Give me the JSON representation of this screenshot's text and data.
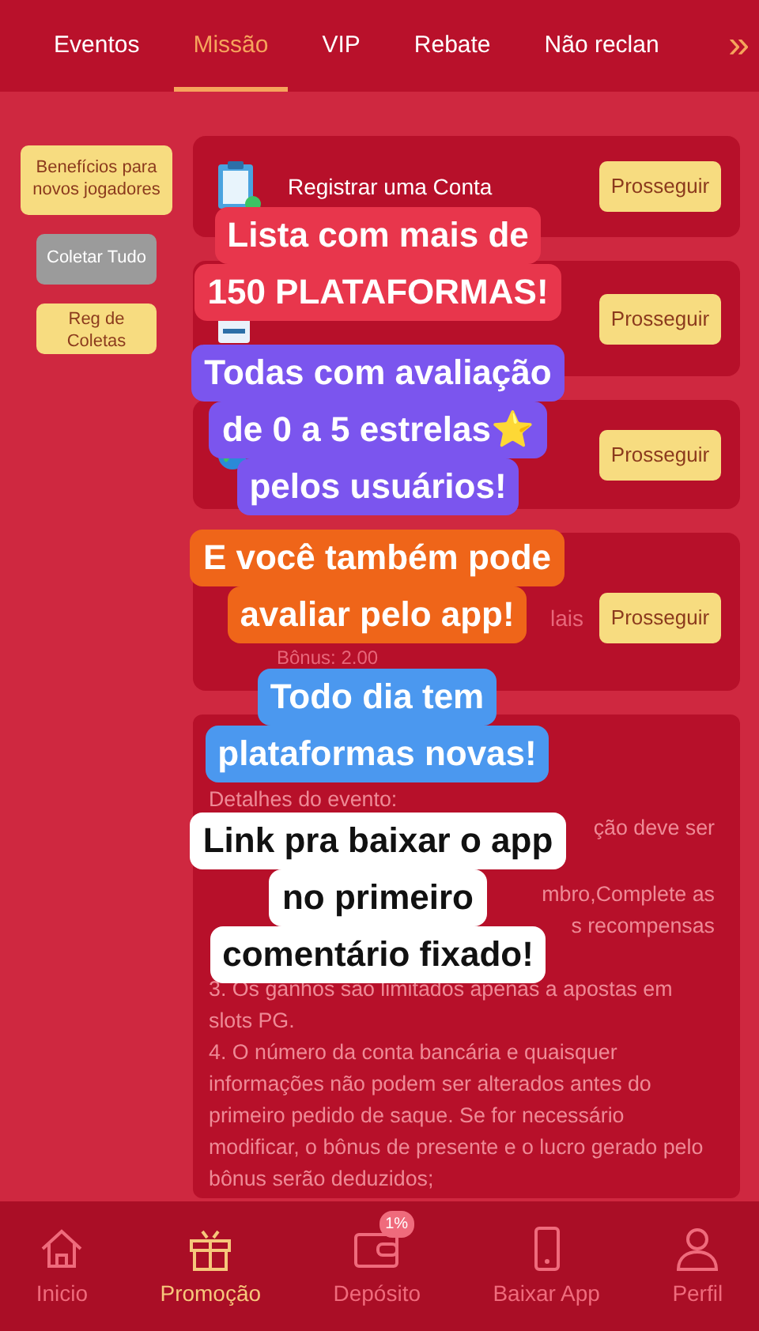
{
  "tabs": [
    {
      "label": "Eventos",
      "selected": false
    },
    {
      "label": "Missão",
      "selected": true
    },
    {
      "label": "VIP",
      "selected": false
    },
    {
      "label": "Rebate",
      "selected": false
    },
    {
      "label": "Não reclan",
      "selected": false
    }
  ],
  "tabs_more": "»",
  "side_buttons": [
    {
      "label": "Benefícios para novos jogadores",
      "kind": "yellow"
    },
    {
      "label": "Coletar Tudo",
      "kind": "gray"
    },
    {
      "label": "Reg de Coletas",
      "kind": "yellow"
    }
  ],
  "tasks": [
    {
      "title": "Registrar uma Conta",
      "button": "Prosseguir"
    },
    {
      "button": "Prosseguir"
    },
    {
      "button": "Prosseguir"
    },
    {
      "fragment": "lais",
      "bonus": "Bônus: 2.00",
      "button": "Prosseguir"
    }
  ],
  "details": [
    {
      "text": "Detalhes do evento:",
      "kind": "full"
    },
    {
      "text": "ção deve ser",
      "kind": "fragment"
    },
    {
      "text": "mbro,Complete as",
      "kind": "fragment"
    },
    {
      "text": "s recompensas",
      "kind": "fragment"
    },
    {
      "text": "3. Os ganhos são limitados apenas a apostas em slots PG.",
      "kind": "full"
    },
    {
      "text": "4. O número da conta bancária e quaisquer informações não podem ser alterados antes do primeiro pedido de saque. Se for necessário modificar, o bônus de presente e o lucro gerado pelo bônus serão deduzidos;",
      "kind": "full"
    }
  ],
  "captions": [
    {
      "lines": [
        "Lista com mais de",
        "150 PLATAFORMAS!"
      ],
      "color": "#e8364c"
    },
    {
      "lines": [
        "Todas com avaliação",
        "de 0 a 5 estrelas⭐",
        "pelos usuários!"
      ],
      "color": "#7b55ee"
    },
    {
      "lines": [
        "E você também pode",
        "avaliar pelo app!"
      ],
      "color": "#ef6519"
    },
    {
      "lines": [
        "Todo dia tem",
        "plataformas novas!"
      ],
      "color": "#4b98ef"
    },
    {
      "lines": [
        "Link pra baixar o app",
        "no primeiro",
        "comentário fixado!"
      ],
      "color": "#ffffff"
    }
  ],
  "bottom_nav": [
    {
      "label": "Inicio",
      "selected": false
    },
    {
      "label": "Promoção",
      "selected": true
    },
    {
      "label": "Depósito",
      "selected": false,
      "badge": "1%"
    },
    {
      "label": "Baixar App",
      "selected": false
    },
    {
      "label": "Perfil",
      "selected": false
    }
  ]
}
